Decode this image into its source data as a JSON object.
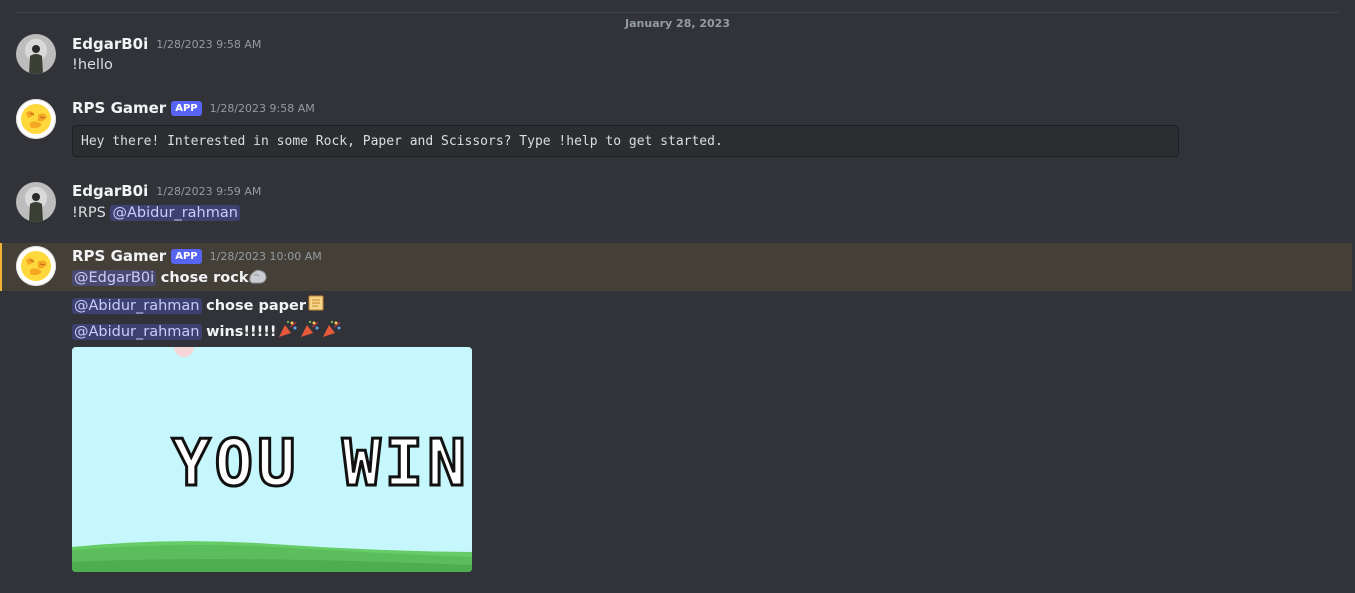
{
  "divider": {
    "date": "January 28, 2023"
  },
  "messages": [
    {
      "username": "EdgarB0i",
      "timestamp": "1/28/2023 9:58 AM",
      "text": "!hello"
    },
    {
      "username": "RPS Gamer",
      "tag": "APP",
      "timestamp": "1/28/2023 9:58 AM",
      "code": "Hey there! Interested in some Rock, Paper and Scissors? Type !help to get started."
    },
    {
      "username": "EdgarB0i",
      "timestamp": "1/28/2023 9:59 AM",
      "text": "!RPS",
      "mention": "@Abidur_rahman"
    },
    {
      "username": "RPS Gamer",
      "tag": "APP",
      "timestamp": "1/28/2023 10:00 AM",
      "lines": [
        {
          "mention": "@EdgarB0i",
          "text": "chose rock"
        },
        {
          "mention": "@Abidur_rahman",
          "text": "chose paper"
        },
        {
          "mention": "@Abidur_rahman",
          "text": "wins!!!!!"
        }
      ],
      "image_text": "YOU WIN"
    }
  ],
  "icons": {
    "rock": "rock-emoji-icon",
    "paper": "scroll-emoji-icon",
    "celebrate": "party-popper-icon"
  },
  "colors": {
    "accent": "#5865f2",
    "highlight_bar": "#f0b232",
    "background": "#313338"
  }
}
